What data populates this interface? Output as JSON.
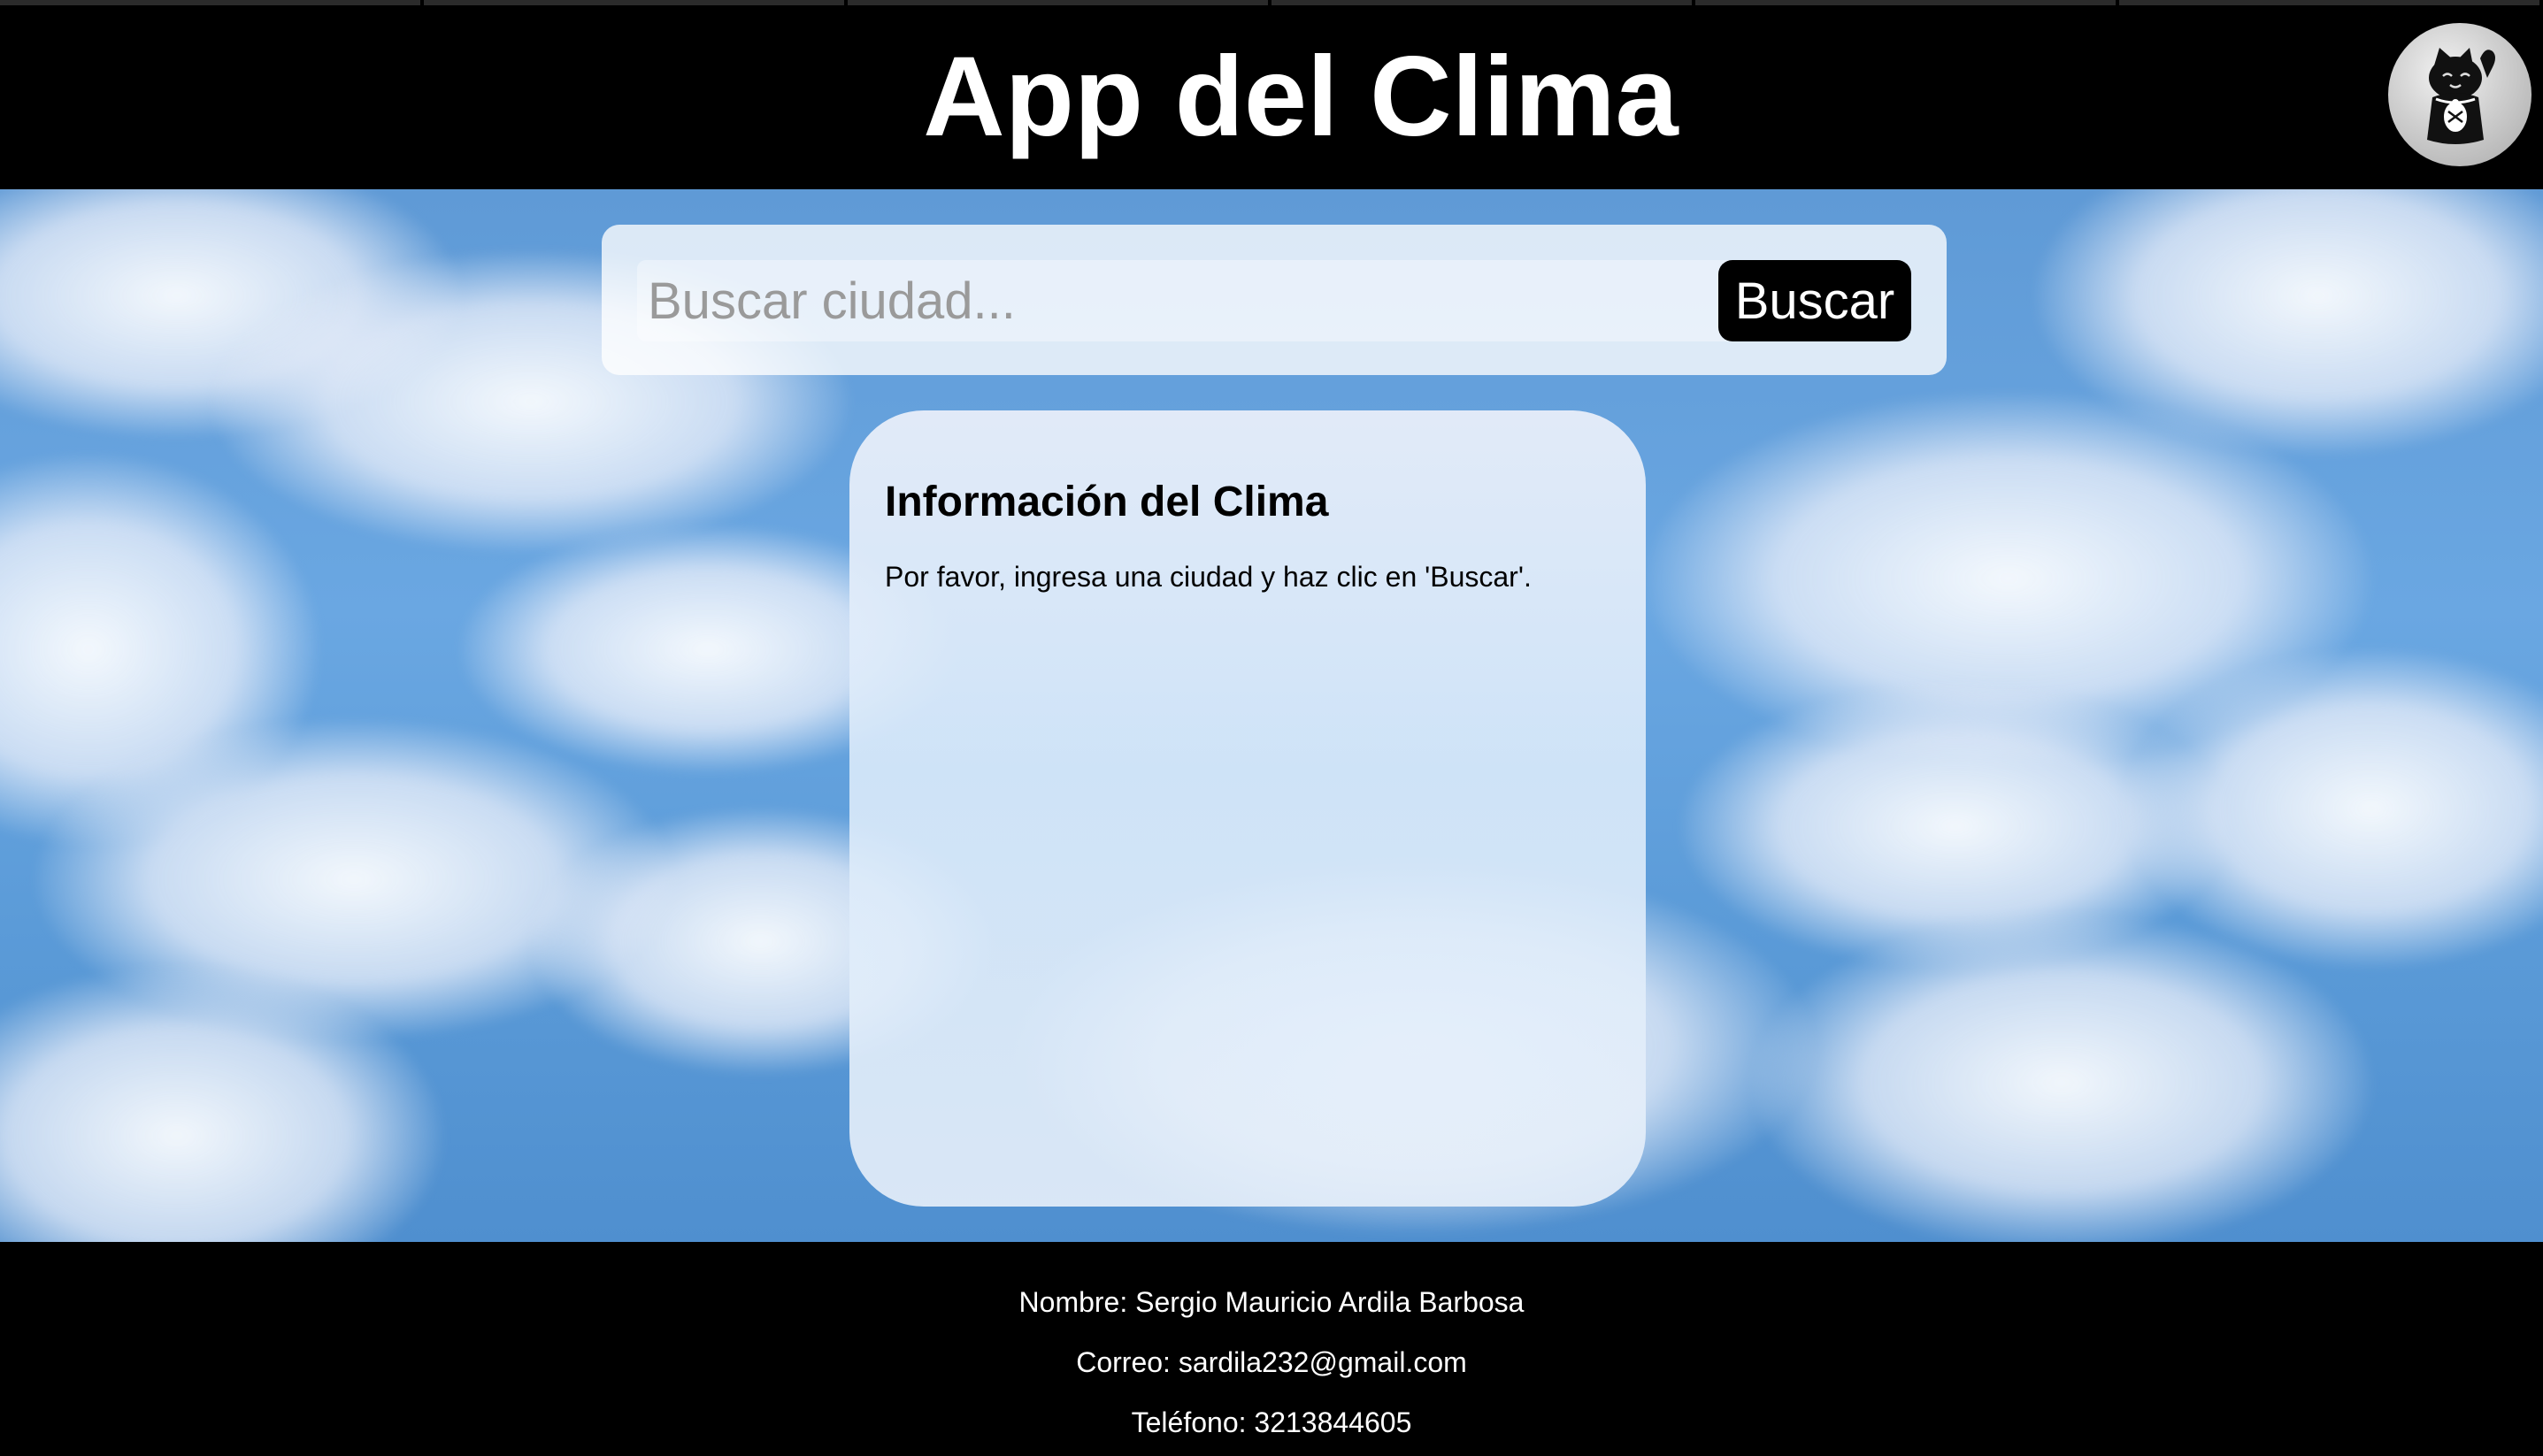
{
  "header": {
    "title": "App del Clima",
    "avatar_icon": "lucky-cat-icon"
  },
  "search": {
    "placeholder": "Buscar ciudad...",
    "value": "",
    "button_label": "Buscar"
  },
  "weather_card": {
    "title": "Información del Clima",
    "message": "Por favor, ingresa una ciudad y haz clic en 'Buscar'."
  },
  "footer": {
    "name": "Nombre: Sergio Mauricio Ardila Barbosa",
    "email": "Correo: sardila232@gmail.com",
    "phone": "Teléfono: 3213844605"
  },
  "colors": {
    "header_bg": "#000000",
    "footer_bg": "#000000",
    "button_bg": "#000000",
    "sky": "#5f9ad6"
  }
}
